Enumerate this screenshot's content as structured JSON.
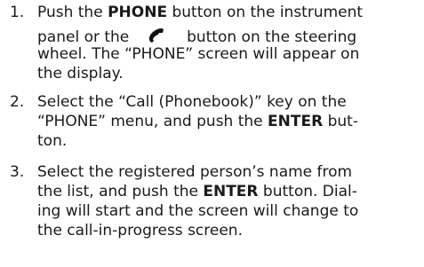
{
  "steps": [
    {
      "number": "1.",
      "line1_pre": "Push the ",
      "line1_bold": "PHONE",
      "line1_post": " button on the instrument",
      "line2_pre": "panel or the",
      "line2_icon": "phone-handset-icon",
      "line2_post": "button on the steering",
      "line3": "wheel. The “PHONE” screen will appear on",
      "line4": "the display."
    },
    {
      "number": "2.",
      "line1": "Select the “Call (Phonebook)” key on the",
      "line2_pre": "“PHONE” menu, and push the ",
      "line2_bold": "ENTER",
      "line2_post": " but-",
      "line3": "ton."
    },
    {
      "number": "3.",
      "line1": "Select the registered person’s name from",
      "line2_pre": "the list, and push the ",
      "line2_bold": "ENTER",
      "line2_post": " button. Dial-",
      "line3": "ing will start and the screen will change to",
      "line4": "the call-in-progress screen."
    }
  ]
}
